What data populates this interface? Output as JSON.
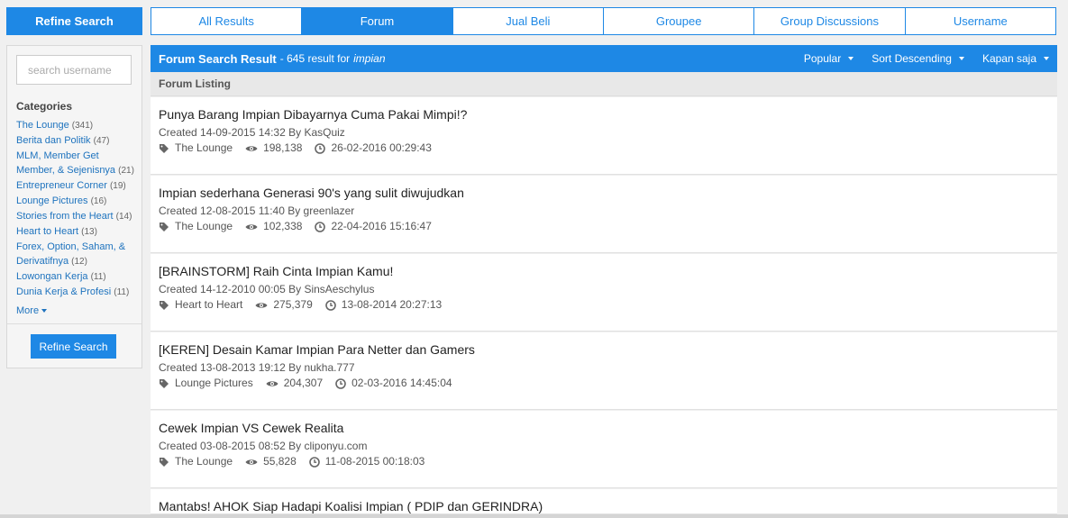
{
  "sidebar": {
    "header": "Refine Search",
    "search_placeholder": "search username",
    "categories_title": "Categories",
    "categories": [
      {
        "label": "The Lounge",
        "count": "(341)"
      },
      {
        "label": "Berita dan Politik",
        "count": "(47)"
      },
      {
        "label": "MLM, Member Get Member, & Sejenisnya",
        "count": "(21)"
      },
      {
        "label": "Entrepreneur Corner",
        "count": "(19)"
      },
      {
        "label": "Lounge Pictures",
        "count": "(16)"
      },
      {
        "label": "Stories from the Heart",
        "count": "(14)"
      },
      {
        "label": "Heart to Heart",
        "count": "(13)"
      },
      {
        "label": "Forex, Option, Saham, & Derivatifnya",
        "count": "(12)"
      },
      {
        "label": "Lowongan Kerja",
        "count": "(11)"
      },
      {
        "label": "Dunia Kerja & Profesi",
        "count": "(11)"
      }
    ],
    "more_label": "More",
    "refine_button": "Refine Search"
  },
  "tabs": [
    {
      "label": "All Results",
      "active": false
    },
    {
      "label": "Forum",
      "active": true
    },
    {
      "label": "Jual Beli",
      "active": false
    },
    {
      "label": "Groupee",
      "active": false
    },
    {
      "label": "Group Discussions",
      "active": false
    },
    {
      "label": "Username",
      "active": false
    }
  ],
  "results": {
    "title": "Forum Search Result",
    "count_text": "- 645 result for",
    "query": "impian",
    "sorts": [
      "Popular",
      "Sort Descending",
      "Kapan saja"
    ],
    "listing_label": "Forum Listing",
    "items": [
      {
        "title": "Punya Barang Impian Dibayarnya Cuma Pakai Mimpi!?",
        "created": "Created 14-09-2015 14:32 By KasQuiz",
        "category": "The Lounge",
        "views": "198,138",
        "last": "26-02-2016 00:29:43"
      },
      {
        "title": "Impian sederhana Generasi 90's yang sulit diwujudkan",
        "created": "Created 12-08-2015 11:40 By greenlazer",
        "category": "The Lounge",
        "views": "102,338",
        "last": "22-04-2016 15:16:47"
      },
      {
        "title": "[BRAINSTORM] Raih Cinta Impian Kamu!",
        "created": "Created 14-12-2010 00:05 By SinsAeschylus",
        "category": "Heart to Heart",
        "views": "275,379",
        "last": "13-08-2014 20:27:13"
      },
      {
        "title": "[KEREN] Desain Kamar Impian Para Netter dan Gamers",
        "created": "Created 13-08-2013 19:12 By nukha.777",
        "category": "Lounge Pictures",
        "views": "204,307",
        "last": "02-03-2016 14:45:04"
      },
      {
        "title": "Cewek Impian VS Cewek Realita",
        "created": "Created 03-08-2015 08:52 By cliponyu.com",
        "category": "The Lounge",
        "views": "55,828",
        "last": "11-08-2015 00:18:03"
      },
      {
        "title": "Mantabs! AHOK Siap Hadapi Koalisi Impian ( PDIP dan GERINDRA)",
        "created": "",
        "category": "",
        "views": "",
        "last": ""
      }
    ]
  }
}
